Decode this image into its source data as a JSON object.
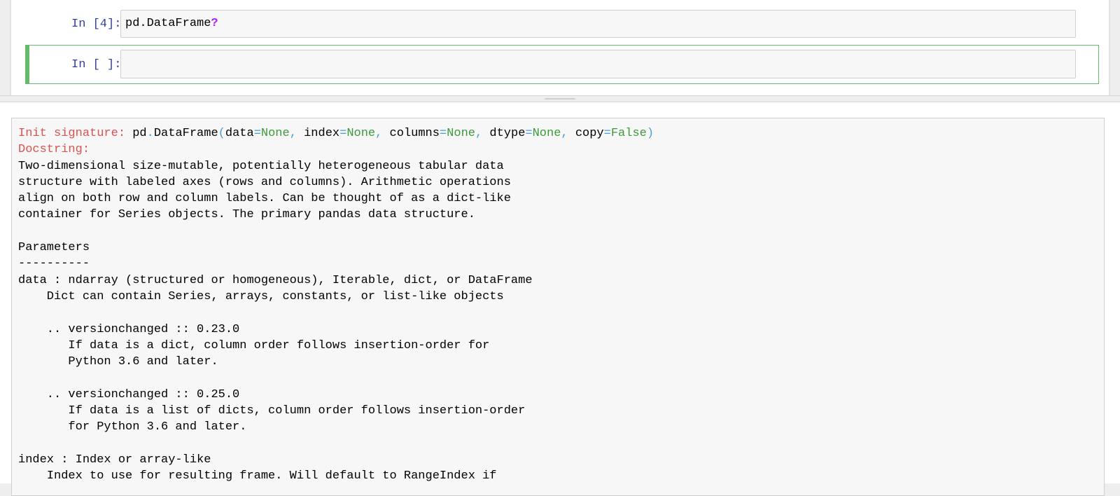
{
  "notebook": {
    "cells": [
      {
        "prompt": "In [4]:",
        "code_prefix": "pd.DataFrame",
        "code_operator": "?"
      },
      {
        "prompt": "In [ ]:",
        "code": ""
      }
    ]
  },
  "pager": {
    "signature": {
      "label": "Init signature:",
      "obj": "pd",
      "dot": ".",
      "name": "DataFrame",
      "open_paren": "(",
      "params": [
        {
          "name": "data",
          "eq": "=",
          "default": "None",
          "sep": ", "
        },
        {
          "name": "index",
          "eq": "=",
          "default": "None",
          "sep": ", "
        },
        {
          "name": "columns",
          "eq": "=",
          "default": "None",
          "sep": ", "
        },
        {
          "name": "dtype",
          "eq": "=",
          "default": "None",
          "sep": ", "
        },
        {
          "name": "copy",
          "eq": "=",
          "default": "False",
          "sep": ""
        }
      ],
      "close_paren": ")"
    },
    "docstring_label": "Docstring:",
    "doc_lines": [
      "Two-dimensional size-mutable, potentially heterogeneous tabular data",
      "structure with labeled axes (rows and columns). Arithmetic operations",
      "align on both row and column labels. Can be thought of as a dict-like",
      "container for Series objects. The primary pandas data structure.",
      "",
      "Parameters",
      "----------",
      "data : ndarray (structured or homogeneous), Iterable, dict, or DataFrame",
      "    Dict can contain Series, arrays, constants, or list-like objects",
      "",
      "    .. versionchanged :: 0.23.0",
      "       If data is a dict, column order follows insertion-order for",
      "       Python 3.6 and later.",
      "",
      "    .. versionchanged :: 0.25.0",
      "       If data is a list of dicts, column order follows insertion-order",
      "       for Python 3.6 and later.",
      "",
      "index : Index or array-like",
      "    Index to use for resulting frame. Will default to RangeIndex if"
    ]
  }
}
